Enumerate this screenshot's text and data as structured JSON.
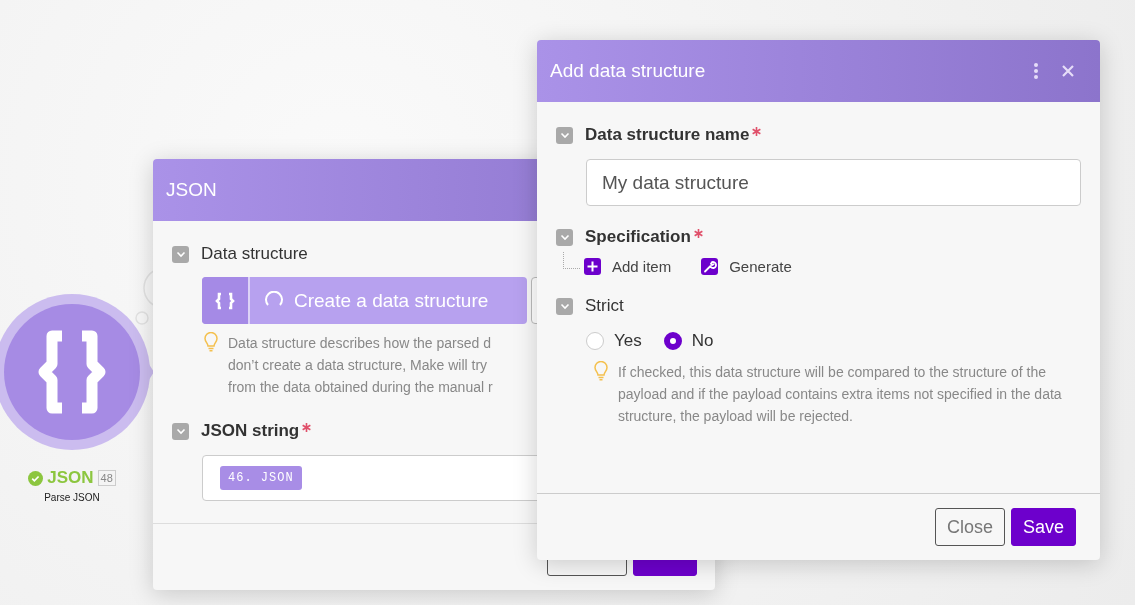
{
  "node": {
    "title": "JSON",
    "count": "48",
    "subtitle": "Parse JSON",
    "success": true
  },
  "module_panel": {
    "title": "JSON",
    "fields": [
      {
        "kind": "structure",
        "label": "Data structure",
        "required": false,
        "expanded": true,
        "button": "Create a data structure",
        "hint_lines": [
          "Data structure describes how the parsed d",
          "don’t create a data structure, Make will try",
          "from the data obtained during the manual r"
        ]
      },
      {
        "kind": "mapping",
        "label": "JSON string",
        "required": true,
        "expanded": true,
        "chip": "46. JSON"
      }
    ],
    "buttons": [
      {
        "kind": "secondary"
      },
      {
        "kind": "primary"
      }
    ]
  },
  "dialog": {
    "title": "Add data structure",
    "fields": [
      {
        "kind": "text",
        "label": "Data structure name",
        "required": true,
        "expanded": true,
        "value": "My data structure"
      },
      {
        "kind": "spec",
        "label": "Specification",
        "required": true,
        "expanded": true,
        "actions": [
          {
            "label": "Add item",
            "kind": "plus"
          },
          {
            "label": "Generate",
            "kind": "wrench"
          }
        ]
      },
      {
        "kind": "radio",
        "label": "Strict",
        "required": false,
        "expanded": true,
        "options": [
          {
            "label": "Yes",
            "selected": false
          },
          {
            "label": "No",
            "selected": true
          }
        ],
        "hint": "If checked, this data structure will be compared to the structure of the payload and if the payload contains extra items not specified in the data structure, the payload will be rejected."
      }
    ],
    "buttons": [
      {
        "label": "Close",
        "kind": "secondary"
      },
      {
        "label": "Save",
        "kind": "primary"
      }
    ]
  }
}
